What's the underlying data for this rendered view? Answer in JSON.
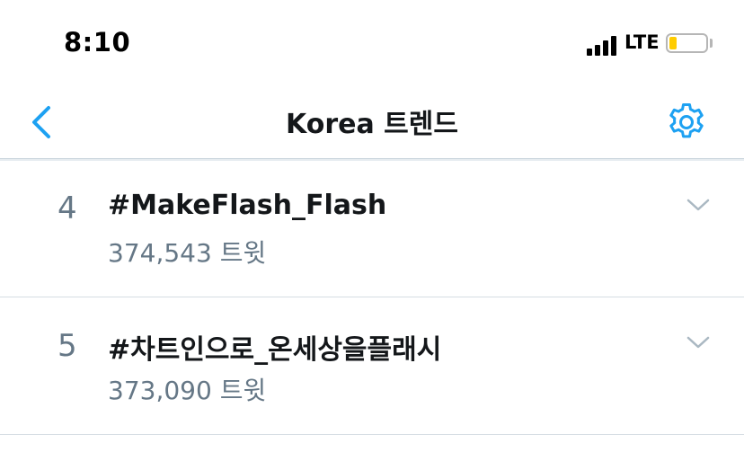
{
  "status_bar": {
    "time": "8:10",
    "network": "LTE",
    "battery_level": 0.2,
    "battery_color": "#ffcc00"
  },
  "nav": {
    "title": "Korea 트렌드",
    "back_icon": "chevron-left-icon",
    "settings_icon": "gear-icon",
    "accent_color": "#1da1f2"
  },
  "trends": [
    {
      "rank": "4",
      "name": "#MakeFlash_Flash",
      "count": "374,543 트윗"
    },
    {
      "rank": "5",
      "name": "#차트인으로_온세상을플래시",
      "count": "373,090 트윗"
    }
  ]
}
